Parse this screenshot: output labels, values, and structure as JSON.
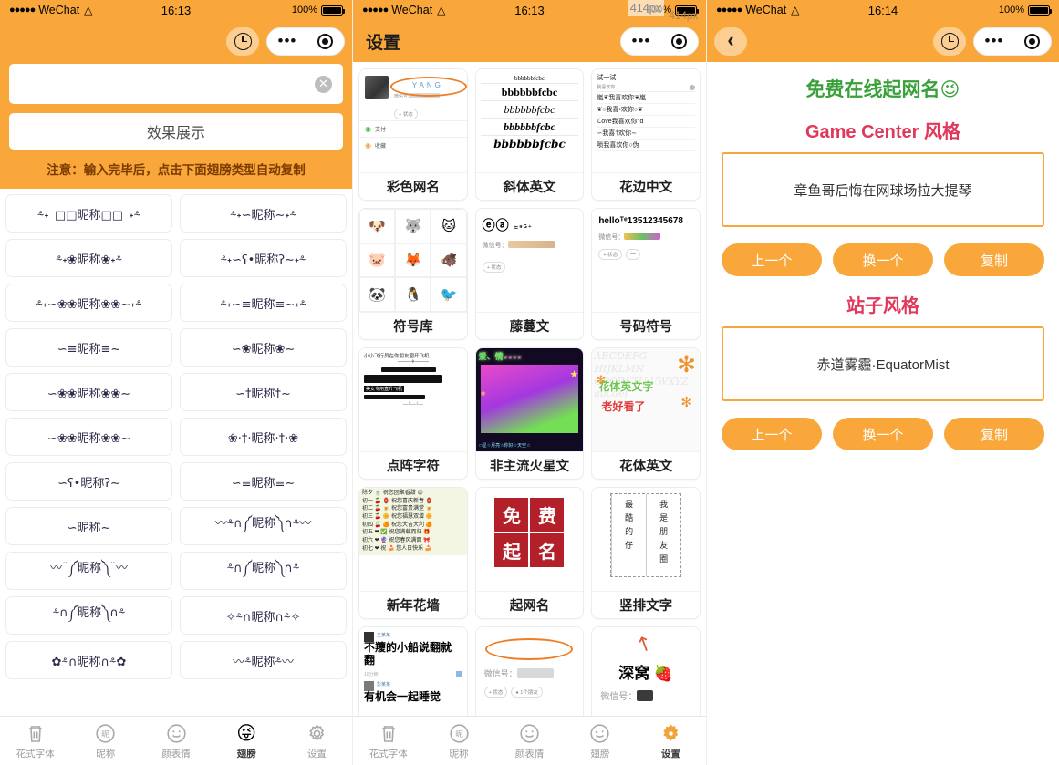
{
  "colors": {
    "brand_orange": "#f9a73a",
    "accent_green": "#3aa03a",
    "accent_pink": "#e0395c",
    "ellipse_orange": "#f07d22",
    "stamp_red": "#b3202a"
  },
  "status_bar": {
    "signal_dots": "●●●●●",
    "carrier": "WeChat",
    "wifi_icon": "wifi-icon",
    "time_left": "16:13",
    "time_mid": "16:13",
    "time_right": "16:14",
    "battery": "100%"
  },
  "overlay": {
    "px_badge": "414px",
    "px_badge_2": "414px"
  },
  "left_panel": {
    "nav": {
      "clock_icon": "clock-icon",
      "more_icon": "more-dots-icon",
      "target_icon": "target-icon"
    },
    "input": {
      "value": "",
      "placeholder": "",
      "clear_icon": "clear-icon"
    },
    "demo_button": "效果展示",
    "note": "注意：输入完毕后，点击下面翅膀类型自动复制",
    "nicknames": [
      "⸛˖ □□昵称□□ ˖⸛",
      "⸛˖∽昵称∼˖⸛",
      "⸛˖❀昵称❀˖⸛",
      "⸛˖∽ʕ•昵称ʔ∼˖⸛",
      "⸛˖∽❀❀昵称❀❀∼˖⸛",
      "⸛˖∽≡昵称≡∼˖⸛",
      "∽≡昵称≡∼",
      "∽❀昵称❀∼",
      "∽❀❀昵称❀❀∼",
      "∽†昵称†∼",
      "∽❀❀昵称❀❀∼",
      "❀·†·昵称·†·❀",
      "∽ʕ•昵称ʔ∼",
      "∽≡昵称≡∼",
      "∽昵称∼",
      "〰⸛∩༼昵称༽∩⸛〰",
      "〰¨༼昵称༽¨〰",
      "⸛∩༼昵称༽∩⸛",
      "⸛∩༼昵称༽∩⸛",
      "✧⸛∩昵称∩⸛✧",
      "✿⸛∩昵称∩⸛✿",
      "〰⸛昵称⸛〰"
    ],
    "tabs": [
      {
        "label": "花式字体",
        "icon": "trash-icon",
        "active": false
      },
      {
        "label": "昵称",
        "icon": "nickname-icon",
        "active": false
      },
      {
        "label": "颜表情",
        "icon": "smiley-icon",
        "active": false
      },
      {
        "label": "翅膀",
        "icon": "wink-icon",
        "active": true
      },
      {
        "label": "设置",
        "icon": "gear-icon",
        "active": false
      }
    ]
  },
  "mid_panel": {
    "nav": {
      "title": "设置",
      "more_icon": "more-dots-icon",
      "target_icon": "target-icon"
    },
    "cards": [
      {
        "label": "彩色网名",
        "thumb": "profile-yang",
        "sample": "YANG",
        "sub1": "支付",
        "sub2": "收藏"
      },
      {
        "label": "斜体英文",
        "thumb": "serif-list",
        "sample": "bbbbbbfcbc"
      },
      {
        "label": "花边中文",
        "thumb": "lace-chinese",
        "sample": "试一试"
      },
      {
        "label": "符号库",
        "thumb": "emoji-grid",
        "sample": "🐶"
      },
      {
        "label": "藤蔓文",
        "thumb": "vine-profile",
        "sample": "微信号："
      },
      {
        "label": "号码符号",
        "thumb": "number-profile",
        "sample": "helloᵀᵉ13512345678"
      },
      {
        "label": "点阵字符",
        "thumb": "dot-matrix",
        "sample": "小小飞行员在你朋友圈开飞机"
      },
      {
        "label": "非主流火星文",
        "thumb": "mars-text",
        "sample": "爱情"
      },
      {
        "label": "花体英文",
        "thumb": "flower-english",
        "sample": "花体英文字",
        "sample2": "老好看了"
      },
      {
        "label": "新年花墙",
        "thumb": "newyear-wall",
        "sample": "除夕祝您团聚香甜"
      },
      {
        "label": "起网名",
        "thumb": "seal-stamp",
        "sample": "免费起名"
      },
      {
        "label": "竖排文字",
        "thumb": "vertical-text",
        "sample": "最酷的仔",
        "sample2": "我是朋友圈"
      },
      {
        "label": "",
        "thumb": "moments-bold",
        "sample": "不羻的小船说翻就翻"
      },
      {
        "label": "",
        "thumb": "ellipse-profile",
        "sample": "微信号："
      },
      {
        "label": "",
        "thumb": "arrow-nest",
        "sample": "深窝"
      }
    ],
    "newyear_lines": [
      "除夕 🍵 祝您团聚香甜 😊",
      "初一 🍒 🏮 祝您喜庆新春 🏮",
      "初二 🍒 🍺 祝您富贵满堂 🍺",
      "初三 🍒 🌼 祝您福慧双增 🌼",
      "初四 🍒 🍊 祝您大吉大利 🍊",
      "初五 ❤ ✅ 祝您满载而归 🎁",
      "初六 ❤ 🔮 祝您春风满面 🎀",
      "初七 ❤ 祝 🍰 您人日快乐 🍰"
    ],
    "serif_lines": [
      "bbbbbbfcbc",
      "bbbbbbfcbc",
      "bbbbbbfcbc",
      "bbbbbbfcbc",
      "bbbbbbfcbc"
    ],
    "lace_lines": [
      "我喜欢你",
      "嵐❦我喜欢你❦嵐",
      "❦○我喜•欢你○❦",
      "ℒove我喜欢你°ɑ",
      "∽我喜†欢你∼",
      "唢我喜欢你○伪"
    ],
    "emoji_icons": [
      "🐶",
      "🐺",
      "🐱",
      "🐷",
      "🦊",
      "🐗",
      "🐼",
      "🐧",
      "🐦"
    ],
    "vertical_cols": [
      [
        "最",
        "酷",
        "的",
        "仔",
        ""
      ],
      [
        "我",
        "是",
        "朋",
        "友",
        "圈"
      ]
    ],
    "tabs": [
      {
        "label": "花式字体",
        "icon": "trash-icon",
        "active": false
      },
      {
        "label": "昵称",
        "icon": "nickname-icon",
        "active": false
      },
      {
        "label": "颜表情",
        "icon": "smiley-icon",
        "active": false
      },
      {
        "label": "翅膀",
        "icon": "wink-icon",
        "active": false
      },
      {
        "label": "设置",
        "icon": "gear-icon",
        "active": true
      }
    ]
  },
  "right_panel": {
    "nav": {
      "back_icon": "back-arrow-icon",
      "clock_icon": "clock-icon",
      "more_icon": "more-dots-icon",
      "target_icon": "target-icon"
    },
    "title": "免费在线起网名😉",
    "sections": [
      {
        "heading": "Game Center 风格",
        "result": "章鱼哥后悔在网球场拉大提琴",
        "buttons": [
          "上一个",
          "换一个",
          "复制"
        ]
      },
      {
        "heading": "站子风格",
        "result": "赤道雾霾·EquatorMist",
        "buttons": [
          "上一个",
          "换一个",
          "复制"
        ]
      }
    ]
  }
}
